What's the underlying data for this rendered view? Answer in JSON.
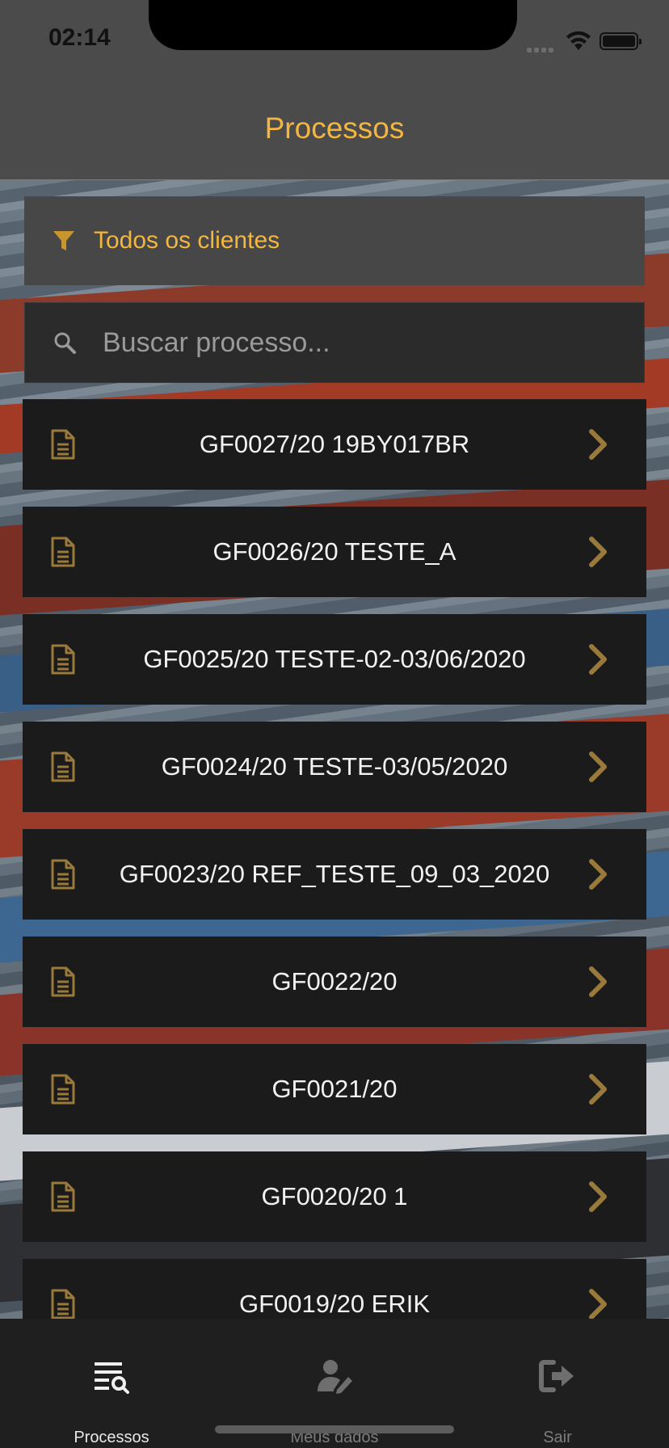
{
  "status_bar": {
    "time": "02:14"
  },
  "header": {
    "title": "Processos"
  },
  "filter": {
    "label": "Todos os clientes"
  },
  "search": {
    "placeholder": "Buscar processo..."
  },
  "processes": [
    {
      "label": "GF0027/20 19BY017BR"
    },
    {
      "label": "GF0026/20 TESTE_A"
    },
    {
      "label": "GF0025/20 TESTE-02-03/06/2020"
    },
    {
      "label": "GF0024/20 TESTE-03/05/2020"
    },
    {
      "label": "GF0023/20 REF_TESTE_09_03_2020"
    },
    {
      "label": "GF0022/20"
    },
    {
      "label": "GF0021/20"
    },
    {
      "label": "GF0020/20 1"
    },
    {
      "label": "GF0019/20 ERIK"
    }
  ],
  "tabs": [
    {
      "label": "Processos",
      "icon": "list-search-icon",
      "active": true
    },
    {
      "label": "Meus dados",
      "icon": "user-edit-icon",
      "active": false
    },
    {
      "label": "Sair",
      "icon": "sign-out-icon",
      "active": false
    }
  ],
  "colors": {
    "accent": "#f3b640",
    "row_bg": "#1b1b1b",
    "icon_gold": "#9a7a3a"
  }
}
